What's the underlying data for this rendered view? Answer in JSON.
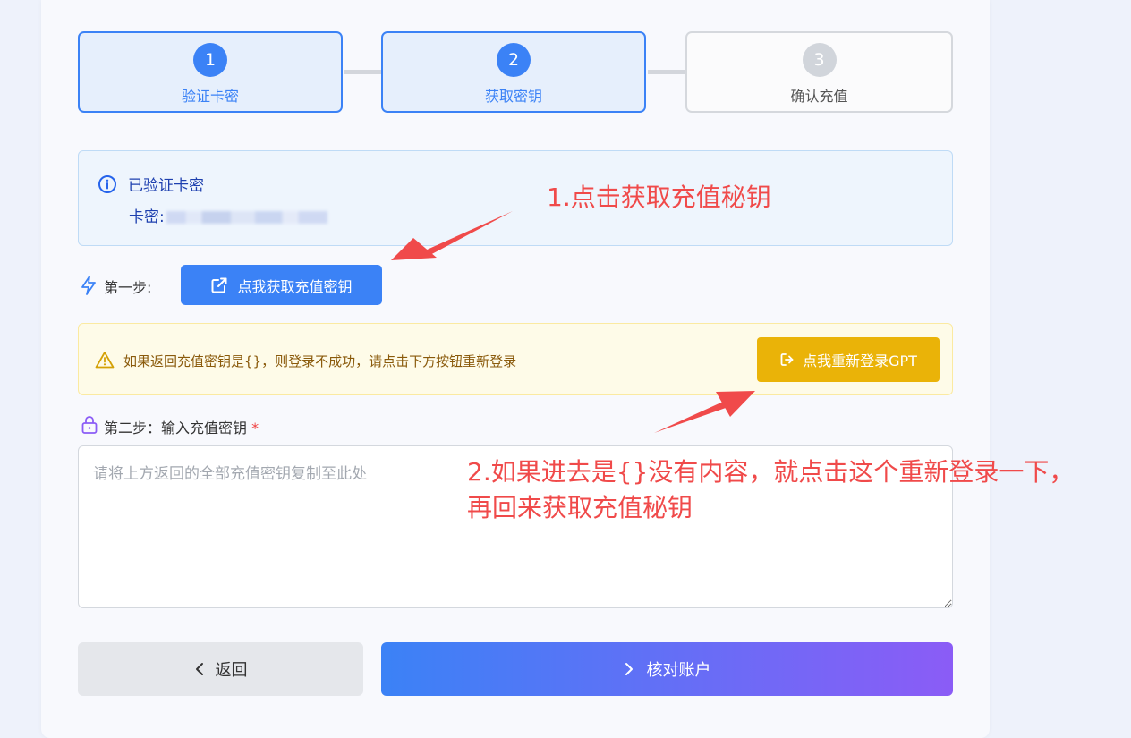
{
  "stepper": {
    "steps": [
      {
        "number": "1",
        "label": "验证卡密"
      },
      {
        "number": "2",
        "label": "获取密钥"
      },
      {
        "number": "3",
        "label": "确认充值"
      }
    ]
  },
  "info": {
    "title": "已验证卡密",
    "card_label": "卡密:"
  },
  "step1": {
    "label": "第一步:",
    "button_label": "点我获取充值密钥"
  },
  "warning": {
    "text": "如果返回充值密钥是{}，则登录不成功，请点击下方按钮重新登录",
    "button_label": "点我重新登录GPT"
  },
  "step2": {
    "label": "第二步：输入充值密钥",
    "required_mark": "*",
    "placeholder": "请将上方返回的全部充值密钥复制至此处"
  },
  "actions": {
    "back_label": "返回",
    "verify_label": "核对账户"
  },
  "annotations": {
    "note1": "1.点击获取充值秘钥",
    "note2_line1": "2.如果进去是{}没有内容，就点击这个重新登录一下，",
    "note2_line2": "再回来获取充值秘钥"
  },
  "colors": {
    "primary": "#3b82f6",
    "warning_button": "#eab308",
    "annotation": "#f04a4a",
    "gradient_end": "#8b5cf6"
  }
}
